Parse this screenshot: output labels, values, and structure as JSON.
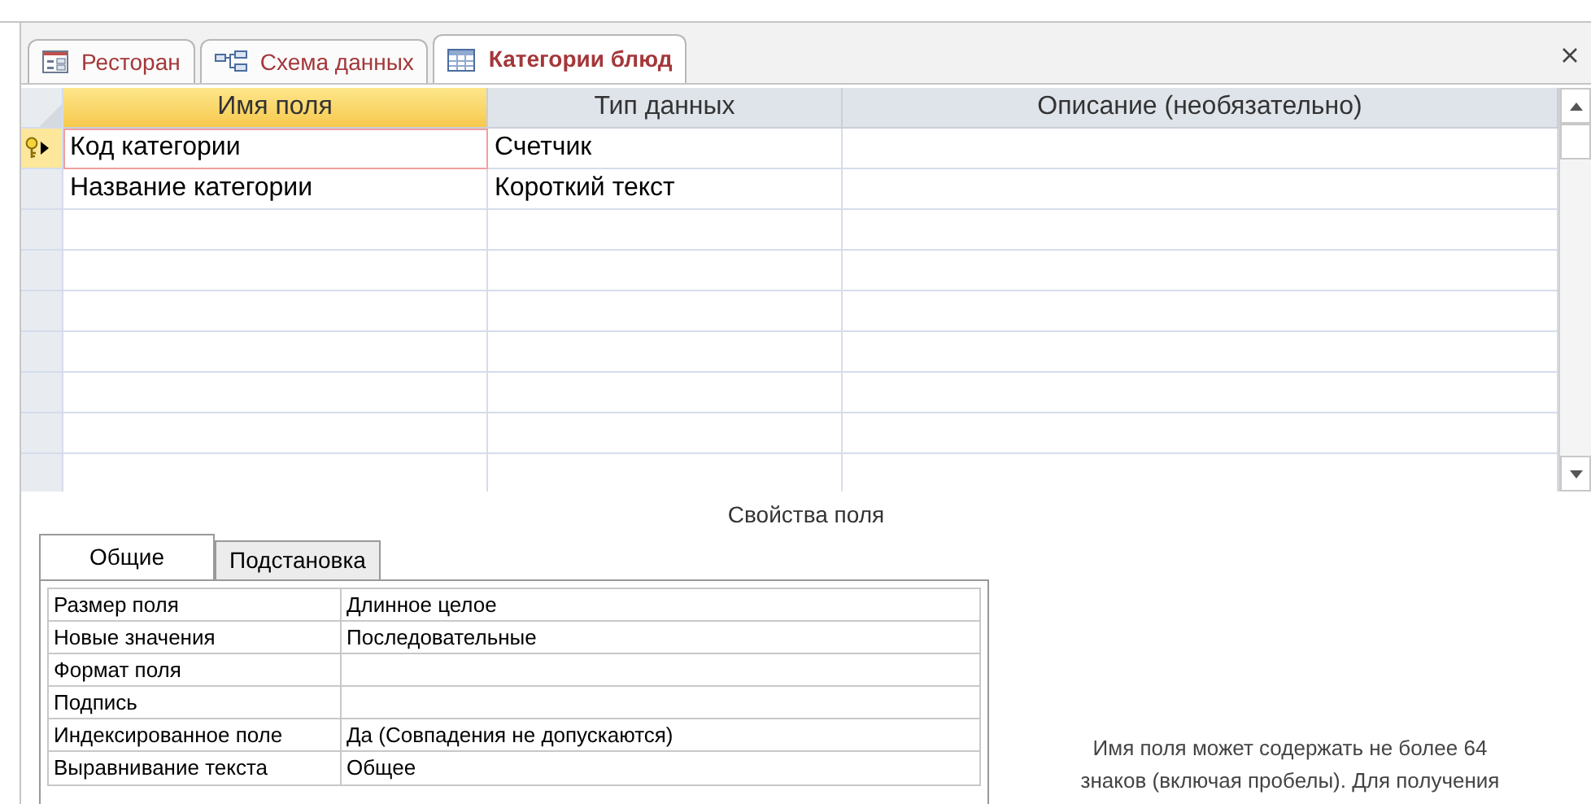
{
  "document_tabs": [
    {
      "label": "Ресторан",
      "kind": "form",
      "selected": false
    },
    {
      "label": "Схема данных",
      "kind": "relationships",
      "selected": false
    },
    {
      "label": "Категории блюд",
      "kind": "table",
      "selected": true
    }
  ],
  "design_grid": {
    "columns": [
      "Имя поля",
      "Тип данных",
      "Описание (необязательно)"
    ],
    "rows": [
      {
        "field_name": "Код категории",
        "data_type": "Счетчик",
        "primary_key": true,
        "selected": true
      },
      {
        "field_name": "Название категории",
        "data_type": "Короткий текст",
        "primary_key": false,
        "selected": false
      }
    ]
  },
  "field_properties": {
    "title": "Свойства поля",
    "tabs": [
      {
        "label": "Общие",
        "selected": true
      },
      {
        "label": "Подстановка",
        "selected": false
      }
    ],
    "rows": [
      {
        "name": "Размер поля",
        "value": "Длинное целое"
      },
      {
        "name": "Новые значения",
        "value": "Последовательные"
      },
      {
        "name": "Формат поля"
      },
      {
        "name": "Подпись"
      },
      {
        "name": "Индексированное поле",
        "value": "Да (Совпадения не допускаются)"
      },
      {
        "name": "Выравнивание текста",
        "value": "Общее"
      }
    ],
    "help_lines": [
      "Имя поля может содержать не более 64",
      "знаков (включая пробелы). Для получения"
    ]
  }
}
